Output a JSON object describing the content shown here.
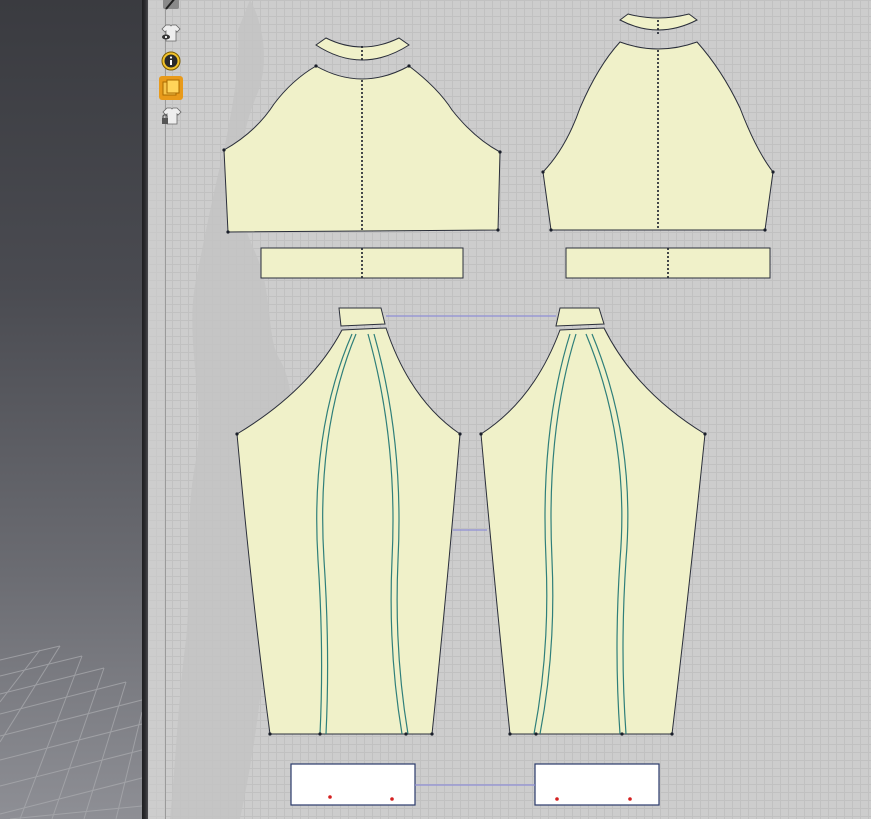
{
  "window": {
    "panels": [
      "3d-viewport",
      "2d-pattern-window"
    ]
  },
  "toolbar": {
    "tools": [
      {
        "name": "brush-tool",
        "icon": "brush-icon"
      },
      {
        "name": "garment-visibility",
        "icon": "shirt-eye-icon"
      },
      {
        "name": "info",
        "icon": "info-icon"
      },
      {
        "name": "fabric-texture",
        "icon": "fabric-icon"
      },
      {
        "name": "locked-garment",
        "icon": "shirt-lock-icon"
      }
    ]
  },
  "colors": {
    "viewport_top": "#3a3b40",
    "viewport_bottom": "#8e8f95",
    "workspace_bg": "#cdcdcd",
    "grid_line": "#c1c1c1",
    "pattern_fill": "#f0f1c9",
    "pattern_outline": "#2a2e3a",
    "seam_line": "#2f7f7a",
    "link_line": "#8f8fd6",
    "pin_marker": "#d42020",
    "accent_orange": "#f0a020"
  },
  "pattern": {
    "pieces": [
      {
        "name": "front-collar-band"
      },
      {
        "name": "front-bodice"
      },
      {
        "name": "front-waistband"
      },
      {
        "name": "back-collar-band"
      },
      {
        "name": "back-bodice"
      },
      {
        "name": "back-waistband"
      },
      {
        "name": "left-sleeve-cuff-collar"
      },
      {
        "name": "left-sleeve"
      },
      {
        "name": "right-sleeve-cuff-collar"
      },
      {
        "name": "right-sleeve"
      },
      {
        "name": "left-sleeve-cuff"
      },
      {
        "name": "right-sleeve-cuff"
      }
    ]
  }
}
